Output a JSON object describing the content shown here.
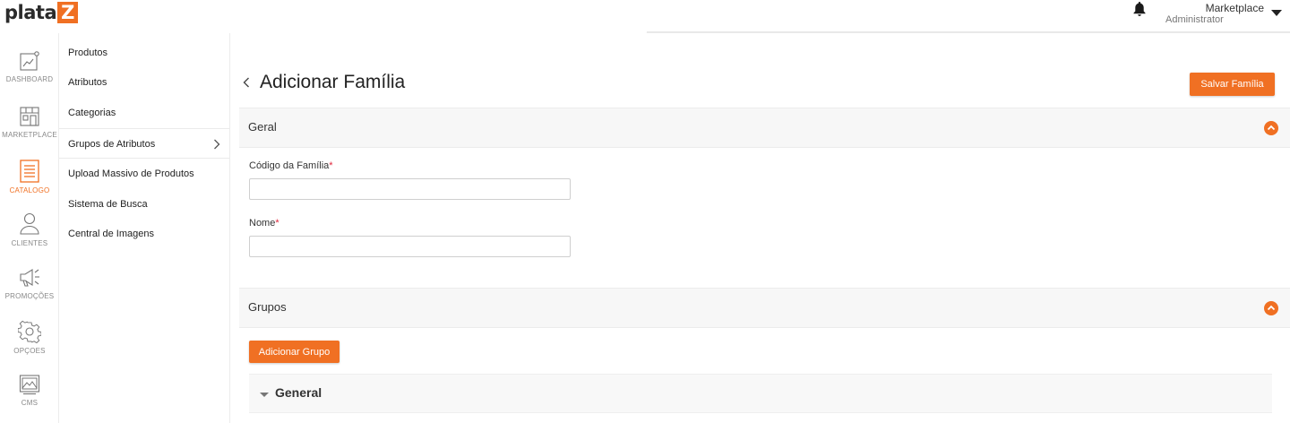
{
  "header": {
    "logo_text": "plata",
    "logo_mark": "Z",
    "user_name": "Marketplace",
    "user_role": "Administrator",
    "icons": [
      "bell-icon",
      "caret-down-icon"
    ]
  },
  "colors": {
    "accent": "#f07023",
    "required": "#e0263b",
    "section_bg": "#f7f7f7"
  },
  "nav": {
    "items": [
      {
        "label": "DASHBOARD",
        "icon": "dashboard-chart-icon"
      },
      {
        "label": "MARKETPLACE",
        "icon": "marketplace-store-icon"
      },
      {
        "label": "CATALOGO",
        "icon": "catalog-list-icon",
        "active": true
      },
      {
        "label": "CLIENTES",
        "icon": "user-icon"
      },
      {
        "label": "PROMOÇÕES",
        "icon": "megaphone-icon"
      },
      {
        "label": "OPÇOES",
        "icon": "gear-icon"
      },
      {
        "label": "CMS",
        "icon": "image-gallery-icon"
      }
    ]
  },
  "submenu": {
    "items": [
      {
        "label": "Produtos"
      },
      {
        "label": "Atributos"
      },
      {
        "label": "Categorias"
      },
      {
        "label": "Grupos de Atributos",
        "active": true
      },
      {
        "label": "Upload Massivo de Produtos"
      },
      {
        "label": "Sistema de Busca"
      },
      {
        "label": "Central de Imagens"
      }
    ]
  },
  "page": {
    "title": "Adicionar Família",
    "save_label": "Salvar Família"
  },
  "sections": {
    "geral": {
      "title": "Geral",
      "code_label": "Código da Família",
      "code_value": "",
      "name_label": "Nome",
      "name_value": "",
      "required_mark": "*"
    },
    "grupos": {
      "title": "Grupos",
      "add_label": "Adicionar Grupo",
      "groups": [
        {
          "title": "General"
        }
      ]
    }
  }
}
